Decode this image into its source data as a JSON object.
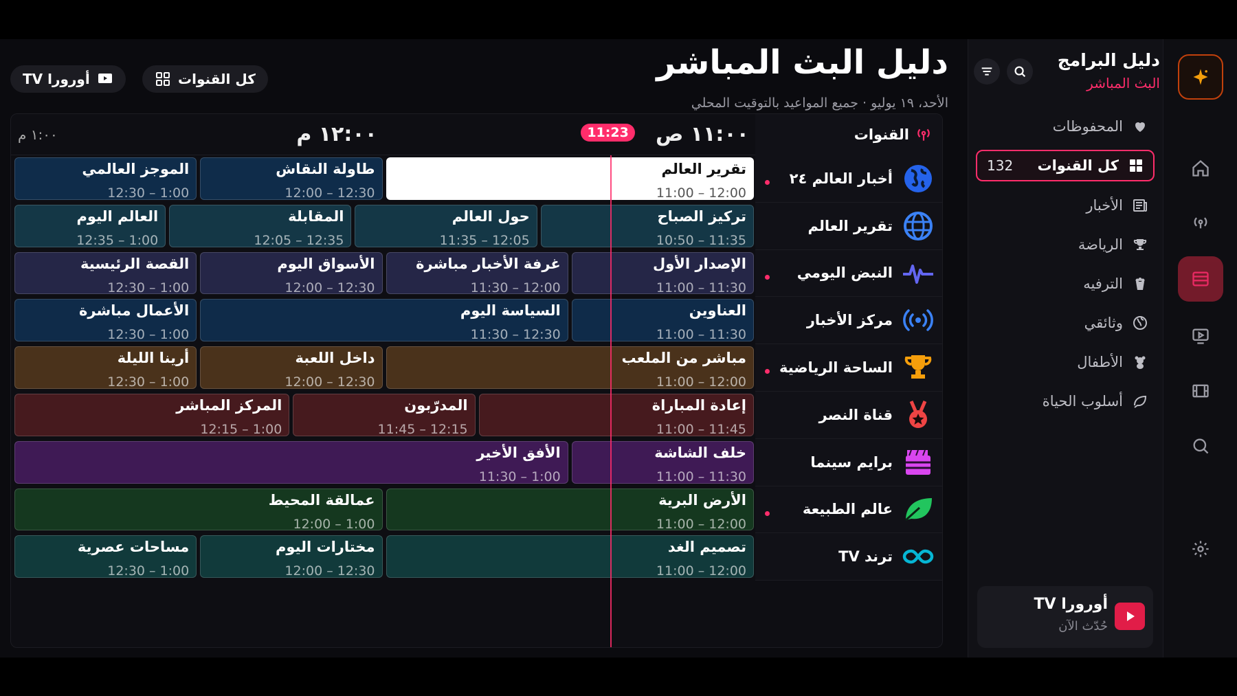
{
  "rail": {
    "items": [
      {
        "name": "ai-sparkle",
        "icon": "sparkle-icon"
      },
      {
        "name": "home",
        "icon": "home-icon"
      },
      {
        "name": "live",
        "icon": "broadcast-icon"
      },
      {
        "name": "guide",
        "icon": "guide-icon",
        "active": true
      },
      {
        "name": "player",
        "icon": "play-screen-icon"
      },
      {
        "name": "movies",
        "icon": "film-icon"
      },
      {
        "name": "search",
        "icon": "search-icon"
      },
      {
        "name": "settings",
        "icon": "gear-icon"
      }
    ]
  },
  "sidebar": {
    "title": "دليل البرامج",
    "subtitle": "البث المباشر",
    "items": [
      {
        "label": "المحفوظات",
        "icon": "heart-icon"
      },
      {
        "label": "كل القنوات",
        "icon": "grid-icon",
        "count": "132",
        "active": true
      },
      {
        "label": "الأخبار",
        "icon": "newspaper-icon"
      },
      {
        "label": "الرياضة",
        "icon": "trophy-icon"
      },
      {
        "label": "الترفيه",
        "icon": "popcorn-icon"
      },
      {
        "label": "وثائقي",
        "icon": "globe-icon"
      },
      {
        "label": "الأطفال",
        "icon": "teddy-icon"
      },
      {
        "label": "أسلوب الحياة",
        "icon": "leaf-icon"
      }
    ],
    "now_playing": {
      "title": "أورورا TV",
      "subtitle": "حُدّث الآن"
    }
  },
  "header": {
    "title": "دليل البث المباشر",
    "subtitle": "الأحد، ١٩ يوليو · جميع المواعيد بالتوقيت المحلي",
    "chip_all": "كل القنوات",
    "chip_brand": "أورورا TV"
  },
  "guide": {
    "channels_label": "القنوات",
    "time_11": "١١:٠٠ ص",
    "time_12": "١٢:٠٠ م",
    "time_1": "١:٠٠ م",
    "now": "11:23",
    "rows": [
      {
        "name": "أخبار العالم ٢٤",
        "live": true,
        "logo": "globe-americas-icon",
        "color": "#0f2c4a",
        "programs": [
          {
            "title": "تقرير العالم",
            "time": "11:00 – 12:00",
            "start": 0,
            "end": 60,
            "selected": true
          },
          {
            "title": "طاولة النقاش",
            "time": "12:00 – 12:30",
            "start": 60,
            "end": 90
          },
          {
            "title": "الموجز العالمي",
            "time": "12:30 – 1:00",
            "start": 90,
            "end": 120
          }
        ]
      },
      {
        "name": "تقرير العالم",
        "live": false,
        "logo": "globe-grid-icon",
        "color": "#143746",
        "programs": [
          {
            "title": "تركيز الصباح",
            "time": "10:50 – 11:35",
            "start": 0,
            "end": 35
          },
          {
            "title": "حول العالم",
            "time": "11:35 – 12:05",
            "start": 35,
            "end": 65
          },
          {
            "title": "المقابلة",
            "time": "12:05 – 12:35",
            "start": 65,
            "end": 95
          },
          {
            "title": "العالم اليوم",
            "time": "12:35 – 1:00",
            "start": 95,
            "end": 120
          }
        ]
      },
      {
        "name": "النبض اليومي",
        "live": true,
        "logo": "pulse-icon",
        "color": "#252647",
        "programs": [
          {
            "title": "الإصدار الأول",
            "time": "11:00 – 11:30",
            "start": 0,
            "end": 30
          },
          {
            "title": "غرفة الأخبار مباشرة",
            "time": "11:30 – 12:00",
            "start": 30,
            "end": 60
          },
          {
            "title": "الأسواق اليوم",
            "time": "12:00 – 12:30",
            "start": 60,
            "end": 90
          },
          {
            "title": "القصة الرئيسية",
            "time": "12:30 – 1:00",
            "start": 90,
            "end": 120
          }
        ]
      },
      {
        "name": "مركز الأخبار",
        "live": false,
        "logo": "signal-icon",
        "color": "#0f2b49",
        "programs": [
          {
            "title": "العناوين",
            "time": "11:00 – 11:30",
            "start": 0,
            "end": 30
          },
          {
            "title": "السياسة اليوم",
            "time": "11:30 – 12:30",
            "start": 30,
            "end": 90
          },
          {
            "title": "الأعمال مباشرة",
            "time": "12:30 – 1:00",
            "start": 90,
            "end": 120
          }
        ]
      },
      {
        "name": "الساحة الرياضية",
        "live": true,
        "logo": "trophy-icon",
        "color": "#4a321b",
        "programs": [
          {
            "title": "مباشر من الملعب",
            "time": "11:00 – 12:00",
            "start": 0,
            "end": 60
          },
          {
            "title": "داخل اللعبة",
            "time": "12:00 – 12:30",
            "start": 60,
            "end": 90
          },
          {
            "title": "أرينا الليلة",
            "time": "12:30 – 1:00",
            "start": 90,
            "end": 120
          }
        ]
      },
      {
        "name": "قناة النصر",
        "live": false,
        "logo": "medal-icon",
        "color": "#461a1e",
        "programs": [
          {
            "title": "إعادة المباراة",
            "time": "11:00 – 11:45",
            "start": 0,
            "end": 45
          },
          {
            "title": "المدرّبون",
            "time": "11:45 – 12:15",
            "start": 45,
            "end": 75
          },
          {
            "title": "المركز المباشر",
            "time": "12:15 – 1:00",
            "start": 75,
            "end": 120
          }
        ]
      },
      {
        "name": "برايم سينما",
        "live": false,
        "logo": "cinema-icon",
        "color": "#3f1a55",
        "programs": [
          {
            "title": "خلف الشاشة",
            "time": "11:00 – 11:30",
            "start": 0,
            "end": 30
          },
          {
            "title": "الأفق الأخير",
            "time": "11:30 – 1:00",
            "start": 30,
            "end": 120
          }
        ]
      },
      {
        "name": "عالم الطبيعة",
        "live": true,
        "logo": "leaf-icon",
        "color": "#15381f",
        "programs": [
          {
            "title": "الأرض البرية",
            "time": "11:00 – 12:00",
            "start": 0,
            "end": 60
          },
          {
            "title": "عمالقة المحيط",
            "time": "12:00 – 1:00",
            "start": 60,
            "end": 120
          }
        ]
      },
      {
        "name": "ترند TV",
        "live": false,
        "logo": "infinity-icon",
        "color": "#113a3b",
        "programs": [
          {
            "title": "تصميم الغد",
            "time": "11:00 – 12:00",
            "start": 0,
            "end": 60
          },
          {
            "title": "مختارات اليوم",
            "time": "12:00 – 12:30",
            "start": 60,
            "end": 90
          },
          {
            "title": "مساحات عصرية",
            "time": "12:30 – 1:00",
            "start": 90,
            "end": 120
          }
        ]
      }
    ]
  },
  "colors": {
    "accent": "#ff2d6b",
    "panel": "#111117"
  }
}
